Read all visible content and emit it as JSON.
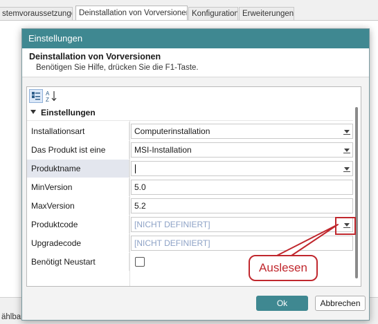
{
  "background": {
    "tabs": [
      {
        "label": "stemvoraussetzungen",
        "active": false
      },
      {
        "label": "Deinstallation von Vorversionen",
        "active": true
      },
      {
        "label": "Konfiguration",
        "active": false
      },
      {
        "label": "Erweiterungen",
        "active": false
      }
    ],
    "bottom_text": "ählbar"
  },
  "dialog": {
    "title": "Einstellungen",
    "header_title": "Deinstallation von Vorversionen",
    "header_subtitle": "Benötigen Sie Hilfe, drücken Sie die F1-Taste.",
    "toolbar": {
      "categorized_icon": "categorized-view-icon",
      "alphabetical_icon": "sort-az-icon"
    },
    "category": "Einstellungen",
    "properties": [
      {
        "name": "Installationsart",
        "value": "Computerinstallation",
        "type": "dropdown"
      },
      {
        "name": "Das Produkt ist eine",
        "value": "MSI-Installation",
        "type": "dropdown"
      },
      {
        "name": "Produktname",
        "value": "",
        "type": "dropdown-edit",
        "selected": true
      },
      {
        "name": "MinVersion",
        "value": "5.0",
        "type": "text"
      },
      {
        "name": "MaxVersion",
        "value": "5.2",
        "type": "text"
      },
      {
        "name": "Produktcode",
        "value": "[NICHT DEFINIERT]",
        "type": "dropdown-button"
      },
      {
        "name": "Upgradecode",
        "value": "[NICHT DEFINIERT]",
        "type": "text-placeholder"
      },
      {
        "name": "Benötigt Neustart",
        "value": false,
        "type": "checkbox"
      }
    ],
    "ok_label": "Ok",
    "cancel_label": "Abbrechen"
  },
  "annotation": {
    "callout_text": "Auslesen",
    "color": "#c0272d"
  },
  "colors": {
    "accent": "#3f8891",
    "placeholder": "#8da2c6"
  }
}
